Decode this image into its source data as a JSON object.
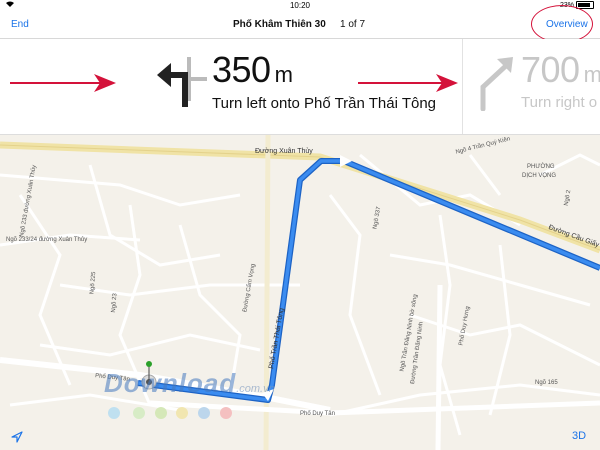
{
  "status_bar": {
    "time": "10:20",
    "battery": "23%",
    "wifi_icon": "wifi-icon"
  },
  "nav": {
    "end_label": "End",
    "title": "Phố Khâm Thiên 30",
    "step_count": "1 of 7",
    "overview_label": "Overview"
  },
  "current_step": {
    "distance": "350",
    "unit": "m",
    "instruction": "Turn left onto Phố Trần Thái Tông",
    "icon": "turn-left-arrow-icon"
  },
  "next_step": {
    "distance": "700",
    "unit": "m",
    "instruction": "Turn right o",
    "icon": "turn-right-arrow-icon"
  },
  "annotations": {
    "highlight_color": "#d4123a"
  },
  "map": {
    "labels": {
      "xuan_thuy_top": "Đường Xuân Thủy",
      "ngo_4": "Ngõ 4 Trần Quý Kiên",
      "phuong_dich_vong_1": "PHƯỜNG",
      "phuong_dich_vong_2": "DỊCH VỌNG",
      "duong_cau_giay": "Đường Cầu Giấy",
      "ngo_337": "Ngõ 337",
      "ngo_233_a": "Ngõ 233 đường Xuân Thủy",
      "ngo_233_b": "Ngõ 233/24 đường Xuân Thủy",
      "ngo_225": "Ngõ 225",
      "ngo_23": "Ngõ 23",
      "pho_tran_thai_tong": "Phố Trần Thái Tông",
      "duong_cam_vong": "Đường Cẩm Vọng",
      "ngo_dang_xanh": "Ngõ Trần Đăng Ninh bờ sông",
      "duong_tran_dang_ninh": "Đường Trần Đăng Ninh",
      "pho_duy_hung": "Phố Duy Hưng",
      "pho_duy_tan_left": "Phố Duy Tân",
      "pho_duy_tan_bottom": "Phố Duy Tân",
      "ngo_165": "Ngõ 165",
      "ngo_2": "Ngõ 2"
    },
    "route_color": "#2f7fe6",
    "watermark": "Download",
    "watermark_domain": ".com.vn"
  },
  "toolbar": {
    "three_d_label": "3D",
    "locate_icon": "location-arrow-icon"
  }
}
